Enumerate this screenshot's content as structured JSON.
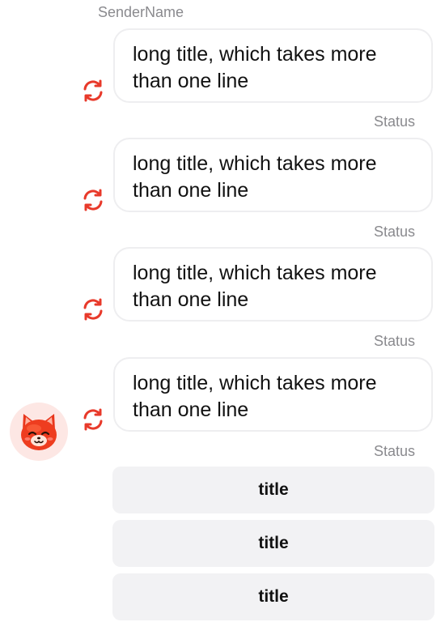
{
  "sender": {
    "name": "SenderName"
  },
  "messages": [
    {
      "text": "long title, which takes more than one line",
      "status": "Status",
      "retry_icon": "refresh-icon"
    },
    {
      "text": "long title, which takes more than one line",
      "status": "Status",
      "retry_icon": "refresh-icon"
    },
    {
      "text": "long title, which takes more than one line",
      "status": "Status",
      "retry_icon": "refresh-icon"
    },
    {
      "text": "long title, which takes more than one line",
      "status": "Status",
      "retry_icon": "refresh-icon"
    }
  ],
  "avatar": {
    "icon": "cat-face-icon"
  },
  "actions": [
    {
      "label": "title"
    },
    {
      "label": "title"
    },
    {
      "label": "title"
    }
  ],
  "colors": {
    "accent_red": "#e8392a",
    "bubble_border": "#eeeef0",
    "secondary_text": "#8a8a8e",
    "button_bg": "#f2f2f4",
    "avatar_bg": "#fde7e4"
  }
}
